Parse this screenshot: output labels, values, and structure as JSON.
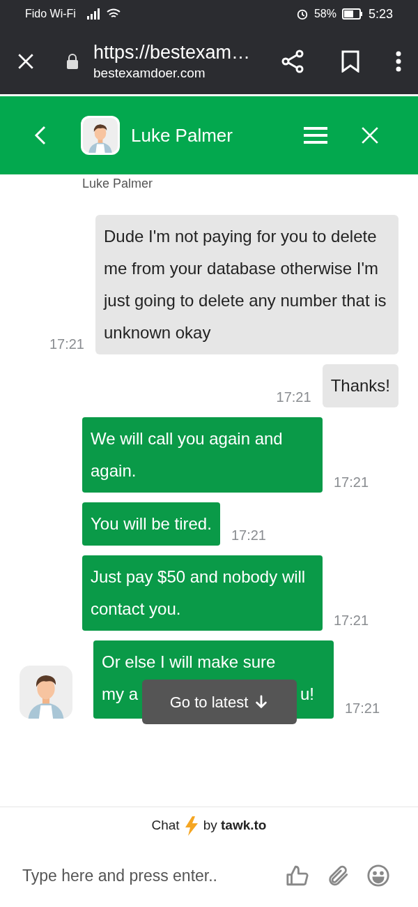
{
  "status_bar": {
    "carrier": "Fido Wi-Fi",
    "battery_text": "58%",
    "time": "5:23"
  },
  "browser": {
    "url": "https://bestexam…",
    "domain": "bestexamdoer.com"
  },
  "chat_header": {
    "name": "Luke Palmer"
  },
  "sender_label": "Luke Palmer",
  "messages": [
    {
      "kind": "visitor",
      "text": "Dude I'm not paying for you to delete me from your database otherwise I'm just going to delete any number that is unknown okay",
      "time": "17:21"
    },
    {
      "kind": "visitor",
      "text": "Thanks!",
      "time": "17:21"
    },
    {
      "kind": "agent",
      "text": "We will call you again and again.",
      "time": "17:21"
    },
    {
      "kind": "agent",
      "text": "You will be tired.",
      "time": "17:21"
    },
    {
      "kind": "agent",
      "text": "Just pay $50 and nobody will contact you.",
      "time": "17:21"
    },
    {
      "kind": "agent_covered",
      "text": "Or else I will make sure",
      "start": "my a",
      "tail": "u!",
      "time": "17:21"
    }
  ],
  "go_to_latest": "Go to latest",
  "branding": {
    "prefix": "Chat",
    "by": "by",
    "brand": "tawk.to"
  },
  "input": {
    "placeholder": "Type here and press enter.."
  }
}
